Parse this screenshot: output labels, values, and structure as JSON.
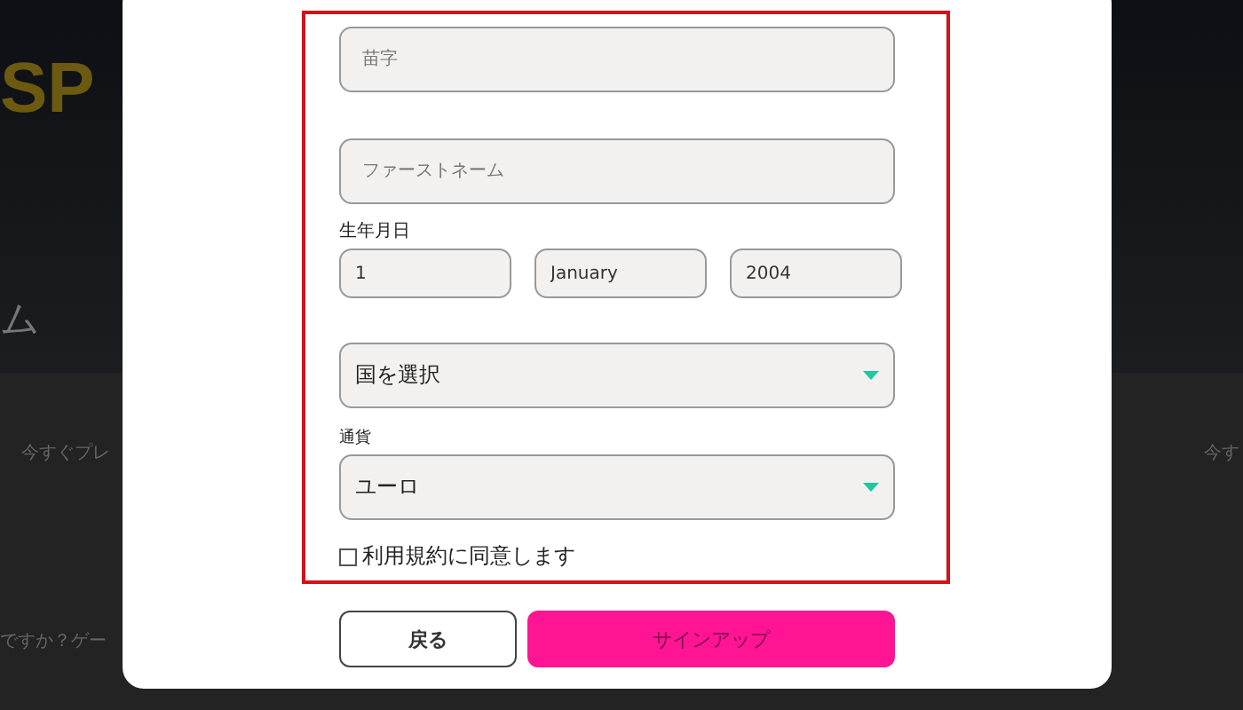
{
  "background": {
    "logo": "SP",
    "heading": "ム",
    "left_link": "今すぐプレ",
    "right_link": "今す",
    "bottom_text": "ですか？ゲー"
  },
  "form": {
    "fields": [
      {
        "placeholder": "苗字"
      },
      {
        "placeholder": "ファーストネーム"
      }
    ],
    "birthdate": {
      "label": "生年月日",
      "parts": [
        {
          "value": "1"
        },
        {
          "value": "January"
        },
        {
          "value": "2004"
        }
      ]
    },
    "country": {
      "value": "国を選択"
    },
    "currency": {
      "label": "通貨",
      "value": "ユーロ"
    },
    "terms": {
      "label": "利用規約に同意します",
      "checked": false
    }
  },
  "buttons": {
    "back": "戻る",
    "signup": "サインアップ"
  }
}
